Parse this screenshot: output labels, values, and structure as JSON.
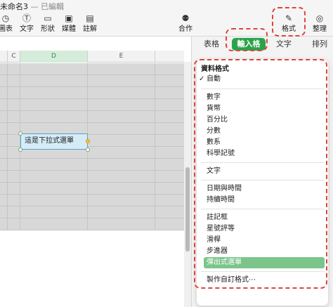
{
  "window": {
    "title": "未命名3",
    "separator": "—",
    "status": "已編輯"
  },
  "toolbar": {
    "tools": [
      {
        "label": "圖表",
        "icon": "chart-icon"
      },
      {
        "label": "文字",
        "icon": "text-icon"
      },
      {
        "label": "形狀",
        "icon": "shape-icon"
      },
      {
        "label": "媒體",
        "icon": "media-icon"
      },
      {
        "label": "註解",
        "icon": "comment-icon"
      },
      {
        "label": "合作",
        "icon": "collaborate-icon"
      },
      {
        "label": "格式",
        "icon": "format-brush-icon"
      },
      {
        "label": "整理",
        "icon": "organize-icon"
      }
    ]
  },
  "sheet": {
    "columns": [
      "C",
      "D",
      "E"
    ],
    "selected_column": "D",
    "selected_cell_text": "這是下拉式選單"
  },
  "inspector": {
    "tabs": [
      "表格",
      "輸入格",
      "文字",
      "排列"
    ],
    "active_tab": "輸入格",
    "menu": {
      "heading": "資料格式",
      "checked_item": "自動",
      "groups": [
        [
          "自動"
        ],
        [
          "數字",
          "貨幣",
          "百分比",
          "分數",
          "數系",
          "科學記號"
        ],
        [
          "文字"
        ],
        [
          "日期與時間",
          "持續時間"
        ],
        [
          "註記框",
          "星號評等",
          "滑桿",
          "步進器",
          "彈出式選單"
        ],
        [
          "製作自訂格式⋯"
        ]
      ],
      "highlighted_item": "彈出式選單"
    }
  },
  "colors": {
    "accent_green": "#2aa34a",
    "highlight_green": "#7bc58b",
    "annotation_red": "#e0443c"
  }
}
